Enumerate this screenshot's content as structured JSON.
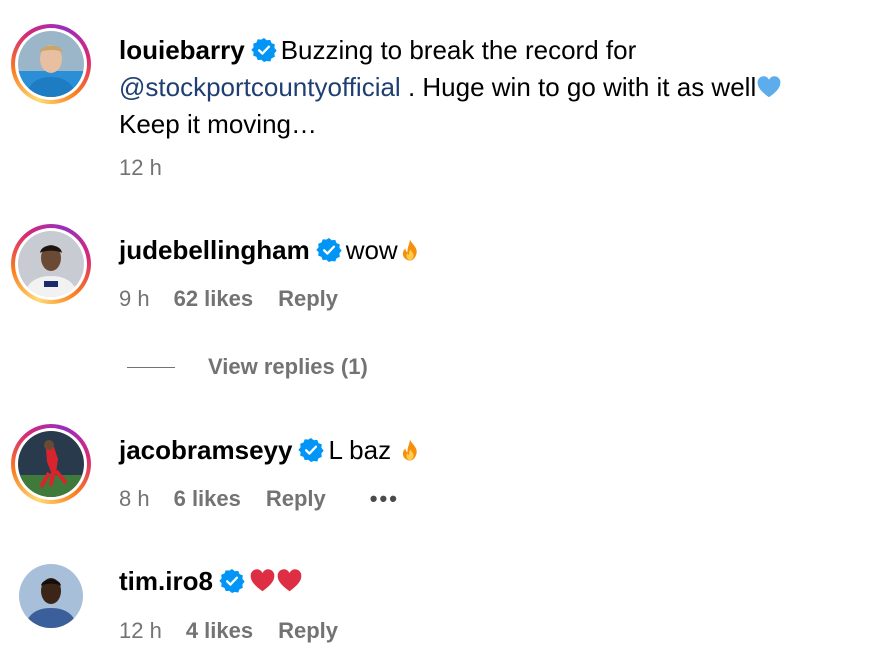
{
  "comments": [
    {
      "username": "louiebarry",
      "text_before": "Buzzing to break the record for",
      "mention": "@stockportcountyofficial",
      "text_after": ". Huge win to go with it as well",
      "text_line3": "Keep it moving…",
      "time": "12 h"
    },
    {
      "username": "judebellingham",
      "text": "wow",
      "emoji": "fire",
      "time": "9 h",
      "likes": "62 likes",
      "reply": "Reply",
      "view_replies": "View replies (1)"
    },
    {
      "username": "jacobramseyy",
      "text": "L baz",
      "emoji": "fire",
      "time": "8 h",
      "likes": "6 likes",
      "reply": "Reply",
      "more": "•••"
    },
    {
      "username": "tim.iro8",
      "emoji": "two-red-hearts",
      "time": "12 h",
      "likes": "4 likes",
      "reply": "Reply"
    }
  ],
  "colors": {
    "verified": "#0095f6",
    "mention": "#1f3f73",
    "meta_gray": "#737373",
    "story_ring": [
      "#feda75",
      "#fa7e1e",
      "#d62976",
      "#962fbf"
    ]
  }
}
